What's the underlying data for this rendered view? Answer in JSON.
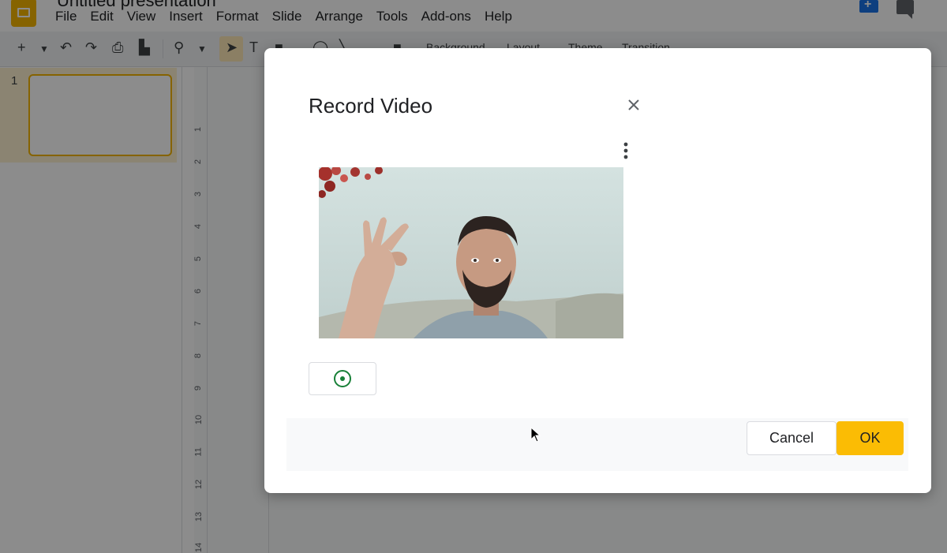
{
  "app": {
    "doc_title": "Untitled presentation",
    "menu": [
      "File",
      "Edit",
      "View",
      "Insert",
      "Format",
      "Slide",
      "Arrange",
      "Tools",
      "Add-ons",
      "Help"
    ],
    "toolbar_labels": [
      "Background",
      "Layout",
      "Theme",
      "Transition"
    ],
    "slide_number": "1",
    "ruler_ticks": [
      "1",
      "2",
      "3",
      "4",
      "5",
      "6",
      "7",
      "8",
      "9",
      "10",
      "11",
      "12",
      "13",
      "14"
    ],
    "accent_color": "#f4b400"
  },
  "dialog": {
    "title": "Record Video",
    "cancel_label": "Cancel",
    "ok_label": "OK",
    "ok_color": "#fbbc04",
    "record_color": "#188038"
  }
}
